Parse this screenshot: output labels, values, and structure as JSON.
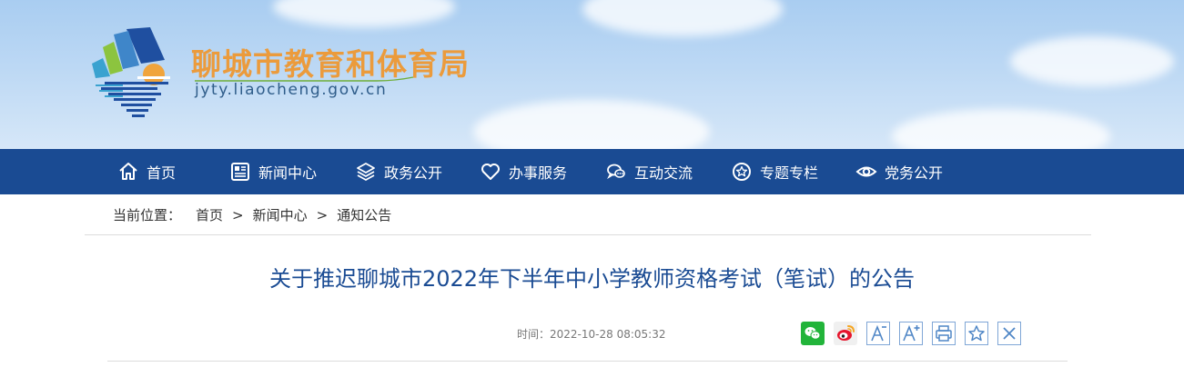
{
  "header": {
    "site_title": "聊城市教育和体育局",
    "site_url": "jyty.liaocheng.gov.cn",
    "logo_icon": "liaocheng-education-logo"
  },
  "nav": {
    "items": [
      {
        "label": "首页",
        "icon": "home-icon"
      },
      {
        "label": "新闻中心",
        "icon": "newspaper-icon"
      },
      {
        "label": "政务公开",
        "icon": "layers-icon"
      },
      {
        "label": "办事服务",
        "icon": "heart-icon"
      },
      {
        "label": "互动交流",
        "icon": "chat-icon"
      },
      {
        "label": "专题专栏",
        "icon": "star-circle-icon"
      },
      {
        "label": "党务公开",
        "icon": "eye-icon"
      }
    ]
  },
  "breadcrumb": {
    "label": "当前位置：",
    "items": [
      "首页",
      "新闻中心",
      "通知公告"
    ],
    "separator": ">"
  },
  "article": {
    "title": "关于推迟聊城市2022年下半年中小学教师资格考试（笔试）的公告",
    "time_label": "时间：",
    "time_value": "2022-10-28 08:05:32"
  },
  "share": {
    "buttons": [
      "wechat-icon",
      "weibo-icon",
      "font-decrease-icon",
      "font-increase-icon",
      "print-icon",
      "favorite-icon",
      "close-icon"
    ]
  },
  "colors": {
    "nav_bg": "#1a4b93",
    "title_orange": "#eb9b3c",
    "article_title": "#1a4b93",
    "share_blue": "#4f86c6"
  }
}
